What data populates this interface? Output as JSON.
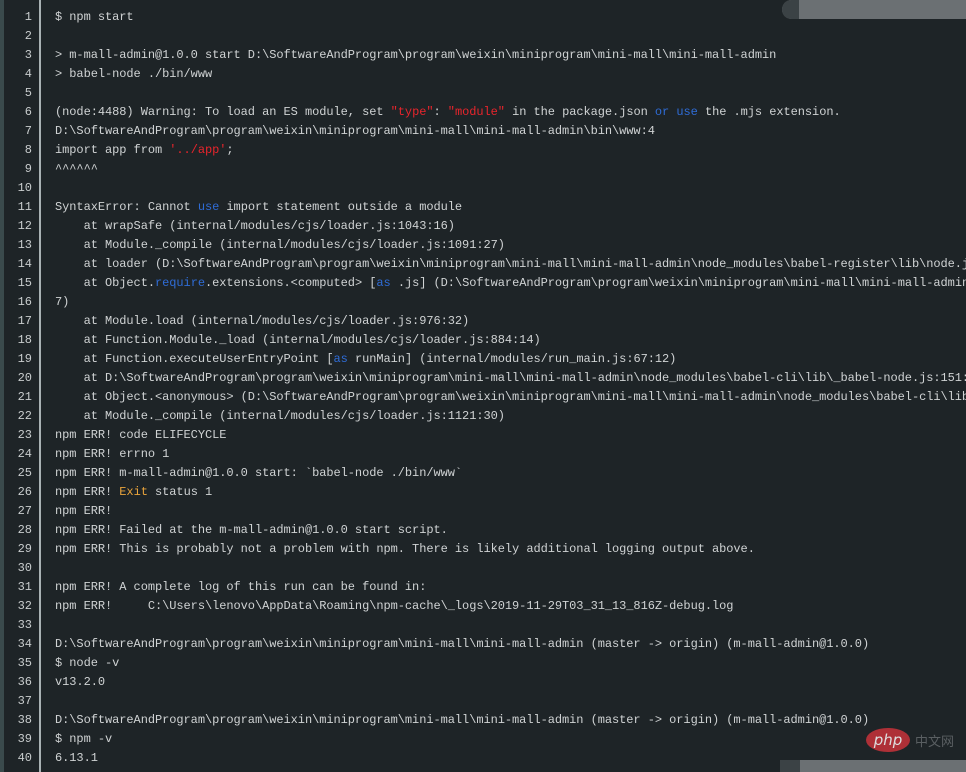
{
  "colors": {
    "background": "#1e2427",
    "text": "#d0d3d4",
    "string": "#e8242c",
    "keyword": "#2f6cd6",
    "highlight": "#e9a43c"
  },
  "watermark": {
    "logo": "php",
    "text": "中文网"
  },
  "lines": [
    {
      "num": "1",
      "segs": [
        {
          "t": "$ npm start"
        }
      ]
    },
    {
      "num": "2",
      "segs": []
    },
    {
      "num": "3",
      "segs": [
        {
          "t": "> m-mall-admin@1.0.0 start D:\\SoftwareAndProgram\\program\\weixin\\miniprogram\\mini-mall\\mini-mall-admin"
        }
      ]
    },
    {
      "num": "4",
      "segs": [
        {
          "t": "> babel-node ./bin/www"
        }
      ]
    },
    {
      "num": "5",
      "segs": []
    },
    {
      "num": "6",
      "segs": [
        {
          "t": "(node:4488) Warning: To load an ES module, set "
        },
        {
          "t": "\"type\"",
          "c": "str"
        },
        {
          "t": ": "
        },
        {
          "t": "\"module\"",
          "c": "str"
        },
        {
          "t": " in the package.json "
        },
        {
          "t": "or",
          "c": "kw"
        },
        {
          "t": " "
        },
        {
          "t": "use",
          "c": "kw"
        },
        {
          "t": " the .mjs extension."
        }
      ]
    },
    {
      "num": "7",
      "segs": [
        {
          "t": "D:\\SoftwareAndProgram\\program\\weixin\\miniprogram\\mini-mall\\mini-mall-admin\\bin\\www:4"
        }
      ]
    },
    {
      "num": "8",
      "segs": [
        {
          "t": "import app from "
        },
        {
          "t": "'../app'",
          "c": "str"
        },
        {
          "t": ";"
        }
      ]
    },
    {
      "num": "9",
      "segs": [
        {
          "t": "^^^^^^"
        }
      ]
    },
    {
      "num": "10",
      "segs": []
    },
    {
      "num": "11",
      "segs": [
        {
          "t": "SyntaxError: Cannot "
        },
        {
          "t": "use",
          "c": "kw"
        },
        {
          "t": " import statement outside a module"
        }
      ]
    },
    {
      "num": "12",
      "segs": [
        {
          "t": "    at wrapSafe (internal/modules/cjs/loader.js:1043:16)"
        }
      ]
    },
    {
      "num": "13",
      "segs": [
        {
          "t": "    at Module._compile (internal/modules/cjs/loader.js:1091:27)"
        }
      ]
    },
    {
      "num": "14",
      "segs": [
        {
          "t": "    at loader (D:\\SoftwareAndProgram\\program\\weixin\\miniprogram\\mini-mall\\mini-mall-admin\\node_modules\\babel-register\\lib\\node.j"
        }
      ]
    },
    {
      "num": "15",
      "segs": [
        {
          "t": "    at Object."
        },
        {
          "t": "require",
          "c": "kw"
        },
        {
          "t": ".extensions.<computed> ["
        },
        {
          "t": "as",
          "c": "kw"
        },
        {
          "t": " .js] (D:\\SoftwareAndProgram\\program\\weixin\\miniprogram\\mini-mall\\mini-mall-admin"
        }
      ]
    },
    {
      "num": "16",
      "segs": [
        {
          "t": "7)"
        }
      ]
    },
    {
      "num": "17",
      "segs": [
        {
          "t": "    at Module.load (internal/modules/cjs/loader.js:976:32)"
        }
      ]
    },
    {
      "num": "18",
      "segs": [
        {
          "t": "    at Function.Module._load (internal/modules/cjs/loader.js:884:14)"
        }
      ]
    },
    {
      "num": "19",
      "segs": [
        {
          "t": "    at Function.executeUserEntryPoint ["
        },
        {
          "t": "as",
          "c": "kw"
        },
        {
          "t": " runMain] (internal/modules/run_main.js:67:12)"
        }
      ]
    },
    {
      "num": "20",
      "segs": [
        {
          "t": "    at D:\\SoftwareAndProgram\\program\\weixin\\miniprogram\\mini-mall\\mini-mall-admin\\node_modules\\babel-cli\\lib\\_babel-node.js:151:"
        }
      ]
    },
    {
      "num": "21",
      "segs": [
        {
          "t": "    at Object.<anonymous> (D:\\SoftwareAndProgram\\program\\weixin\\miniprogram\\mini-mall\\mini-mall-admin\\node_modules\\babel-cli\\lib"
        }
      ]
    },
    {
      "num": "22",
      "segs": [
        {
          "t": "    at Module._compile (internal/modules/cjs/loader.js:1121:30)"
        }
      ]
    },
    {
      "num": "23",
      "segs": [
        {
          "t": "npm ERR! code ELIFECYCLE"
        }
      ]
    },
    {
      "num": "24",
      "segs": [
        {
          "t": "npm ERR! errno 1"
        }
      ]
    },
    {
      "num": "25",
      "segs": [
        {
          "t": "npm ERR! m-mall-admin@1.0.0 start: `babel-node ./bin/www`"
        }
      ]
    },
    {
      "num": "26",
      "segs": [
        {
          "t": "npm ERR! "
        },
        {
          "t": "Exit",
          "c": "orange"
        },
        {
          "t": " status 1"
        }
      ]
    },
    {
      "num": "27",
      "segs": [
        {
          "t": "npm ERR!"
        }
      ]
    },
    {
      "num": "28",
      "segs": [
        {
          "t": "npm ERR! Failed at the m-mall-admin@1.0.0 start script."
        }
      ]
    },
    {
      "num": "29",
      "segs": [
        {
          "t": "npm ERR! This is probably not a problem with npm. There is likely additional logging output above."
        }
      ]
    },
    {
      "num": "30",
      "segs": []
    },
    {
      "num": "31",
      "segs": [
        {
          "t": "npm ERR! A complete log of this run can be found in:"
        }
      ]
    },
    {
      "num": "32",
      "segs": [
        {
          "t": "npm ERR!     C:\\Users\\lenovo\\AppData\\Roaming\\npm-cache\\_logs\\2019-11-29T03_31_13_816Z-debug.log"
        }
      ]
    },
    {
      "num": "33",
      "segs": []
    },
    {
      "num": "34",
      "segs": [
        {
          "t": "D:\\SoftwareAndProgram\\program\\weixin\\miniprogram\\mini-mall\\mini-mall-admin (master -> origin) (m-mall-admin@1.0.0)"
        }
      ]
    },
    {
      "num": "35",
      "segs": [
        {
          "t": "$ node -v"
        }
      ]
    },
    {
      "num": "36",
      "segs": [
        {
          "t": "v13.2.0"
        }
      ]
    },
    {
      "num": "37",
      "segs": []
    },
    {
      "num": "38",
      "segs": [
        {
          "t": "D:\\SoftwareAndProgram\\program\\weixin\\miniprogram\\mini-mall\\mini-mall-admin (master -> origin) (m-mall-admin@1.0.0)"
        }
      ]
    },
    {
      "num": "39",
      "segs": [
        {
          "t": "$ npm -v"
        }
      ]
    },
    {
      "num": "40",
      "segs": [
        {
          "t": "6.13.1"
        }
      ]
    }
  ]
}
